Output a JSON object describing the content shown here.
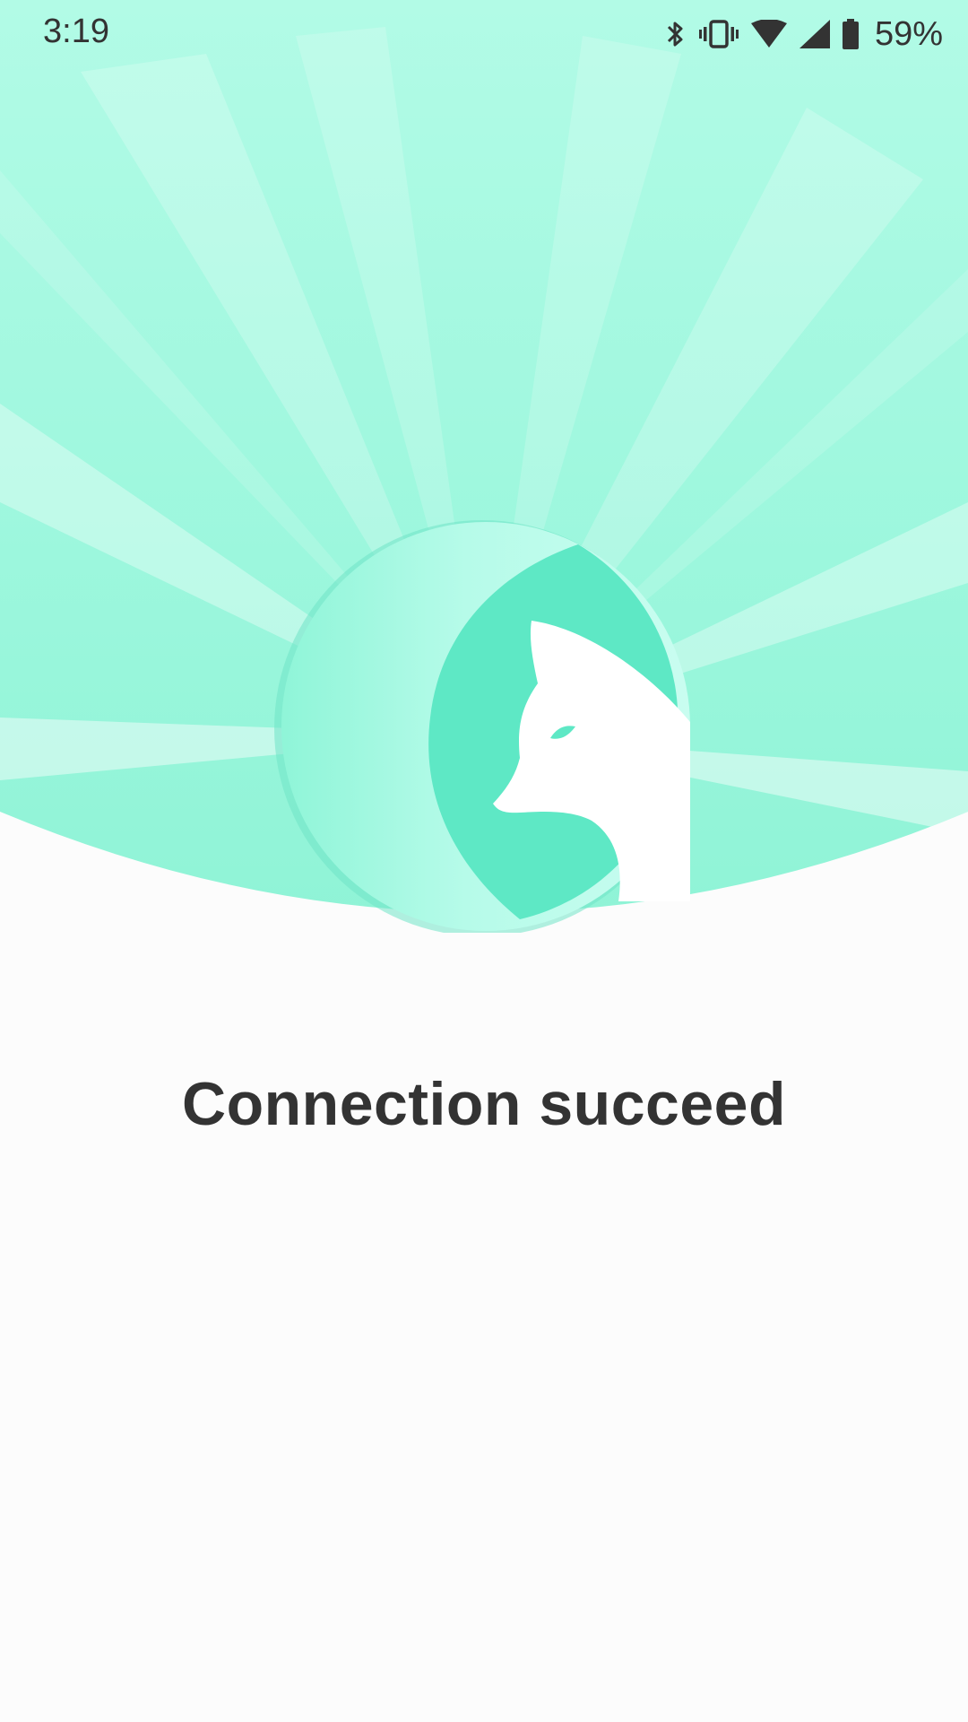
{
  "status_bar": {
    "time": "3:19",
    "battery_percent": "59%",
    "icons": [
      "bluetooth-icon",
      "vibrate-icon",
      "wifi-icon",
      "cell-signal-icon",
      "battery-icon"
    ]
  },
  "logo": {
    "icon": "fox-icon"
  },
  "message": {
    "text": "Connection succeed"
  },
  "colors": {
    "accent": "#5ee8c5",
    "accent_dark": "#55d9b7",
    "hero_light": "#b5fbe9",
    "background": "#fcfcfc",
    "text": "#333333"
  }
}
